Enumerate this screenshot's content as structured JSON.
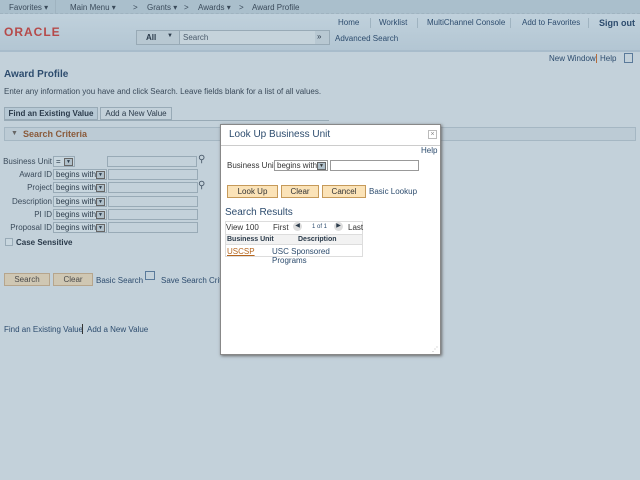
{
  "nav": {
    "favorites": "Favorites ▾",
    "main_menu": "Main Menu ▾",
    "grants": "Grants ▾",
    "awards": "Awards ▾",
    "award_profile": "Award Profile",
    "sep": ">"
  },
  "header": {
    "logo": "ORACLE",
    "links": [
      "Home",
      "Worklist",
      "MultiChannel Console",
      "Add to Favorites"
    ],
    "signout": "Sign out",
    "search_scope": "All",
    "search_placeholder": "Search",
    "advanced_search": "Advanced Search"
  },
  "page": {
    "new_window": "New Window",
    "help": "Help",
    "title": "Award Profile",
    "instructions": "Enter any information you have and click Search. Leave fields blank for a list of all values.",
    "tabs": [
      "Find an Existing Value",
      "Add a New Value"
    ],
    "section": "Search Criteria",
    "fields": [
      {
        "label": "Business Unit",
        "op": "="
      },
      {
        "label": "Award ID",
        "op": "begins with"
      },
      {
        "label": "Project",
        "op": "begins with"
      },
      {
        "label": "Description",
        "op": "begins with"
      },
      {
        "label": "PI ID",
        "op": "begins with"
      },
      {
        "label": "Proposal ID",
        "op": "begins with"
      }
    ],
    "case_sensitive": "Case Sensitive",
    "search": "Search",
    "clear": "Clear",
    "basic_search": "Basic Search",
    "save_search": "Save Search Criteria",
    "footer": [
      "Find an Existing Value",
      "Add a New Value"
    ]
  },
  "modal": {
    "title": "Look Up Business Unit",
    "help": "Help",
    "field_label": "Business Unit",
    "op": "begins with",
    "lookup": "Look Up",
    "clear": "Clear",
    "cancel": "Cancel",
    "basic_lookup": "Basic Lookup",
    "results_title": "Search Results",
    "view100": "View 100",
    "first": "First",
    "pager": "1 of 1",
    "last": "Last",
    "columns": [
      "Business Unit",
      "Description"
    ],
    "rows": [
      [
        "USCSP",
        "USC Sponsored Programs"
      ]
    ]
  },
  "colors": {
    "accent": "#2d4c6e",
    "logo": "#b54a4a",
    "link_result": "#b5651d"
  }
}
